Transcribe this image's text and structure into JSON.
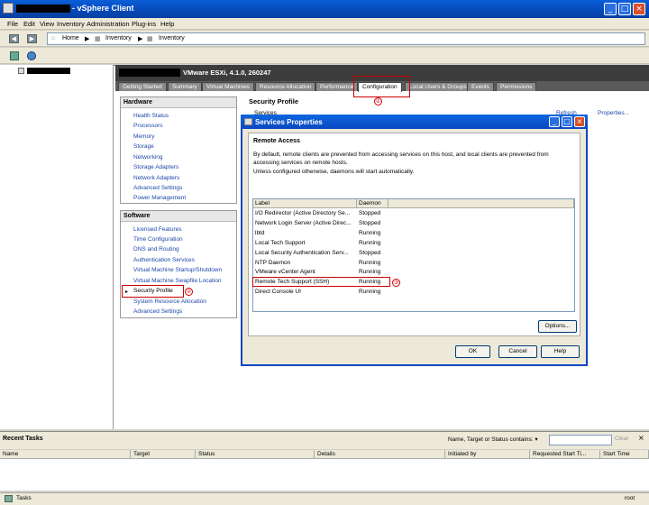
{
  "window": {
    "title": "- vSphere Client"
  },
  "menu": [
    "File",
    "Edit",
    "View",
    "Inventory",
    "Administration",
    "Plug-ins",
    "Help"
  ],
  "breadcrumb": {
    "home": "Home",
    "inventory1": "Inventory",
    "inventory2": "Inventory"
  },
  "host": {
    "title": "VMware ESXi, 4.1.0, 260247"
  },
  "tabs": [
    "Getting Started",
    "Summary",
    "Virtual Machines",
    "Resource Allocation",
    "Performance",
    "Configuration",
    "Local Users & Groups",
    "Events",
    "Permissions"
  ],
  "annotations": {
    "one": "①",
    "two": "②",
    "three": "③"
  },
  "hardware": {
    "title": "Hardware",
    "items": [
      "Health Status",
      "Processors",
      "Memory",
      "Storage",
      "Networking",
      "Storage Adapters",
      "Network Adapters",
      "Advanced Settings",
      "Power Management"
    ]
  },
  "software": {
    "title": "Software",
    "items": [
      "Licensed Features",
      "Time Configuration",
      "DNS and Routing",
      "Authentication Services",
      "Virtual Machine Startup/Shutdown",
      "Virtual Machine Swapfile Location",
      "Security Profile",
      "System Resource Allocation",
      "Advanced Settings"
    ]
  },
  "security": {
    "title": "Security Profile",
    "services": "Services",
    "refresh": "Refresh",
    "properties": "Properties..."
  },
  "dialog": {
    "title": "Services Properties",
    "section": "Remote Access",
    "desc": "By default, remote clients are prevented from accessing services on this host, and local clients are prevented from accessing services on remote hosts.",
    "note": "Unless configured otherwise, daemons will start automatically.",
    "col_label": "Label",
    "col_daemon": "Daemon",
    "rows": [
      {
        "label": "I/O Redirector (Active Directory Se...",
        "daemon": "Stopped"
      },
      {
        "label": "Network Login Server (Active Direc...",
        "daemon": "Stopped"
      },
      {
        "label": "lbtd",
        "daemon": "Running"
      },
      {
        "label": "Local Tech Support",
        "daemon": "Running"
      },
      {
        "label": "Local Security Authentication Serv...",
        "daemon": "Stopped"
      },
      {
        "label": "NTP Daemon",
        "daemon": "Running"
      },
      {
        "label": "VMware vCenter Agent",
        "daemon": "Running"
      },
      {
        "label": "Remote Tech Support (SSH)",
        "daemon": "Running"
      },
      {
        "label": "Direct Console UI",
        "daemon": "Running"
      }
    ],
    "options": "Options...",
    "ok": "OK",
    "cancel": "Cancel",
    "help": "Help"
  },
  "tasks": {
    "title": "Recent Tasks",
    "filter": "Name, Target or Status contains: ▾",
    "clear": "Clear",
    "columns": [
      "Name",
      "Target",
      "Status",
      "Details",
      "Initiated by",
      "Requested Start Ti...",
      "Start Time"
    ]
  },
  "status": {
    "tasks": "Tasks",
    "user": "root"
  }
}
